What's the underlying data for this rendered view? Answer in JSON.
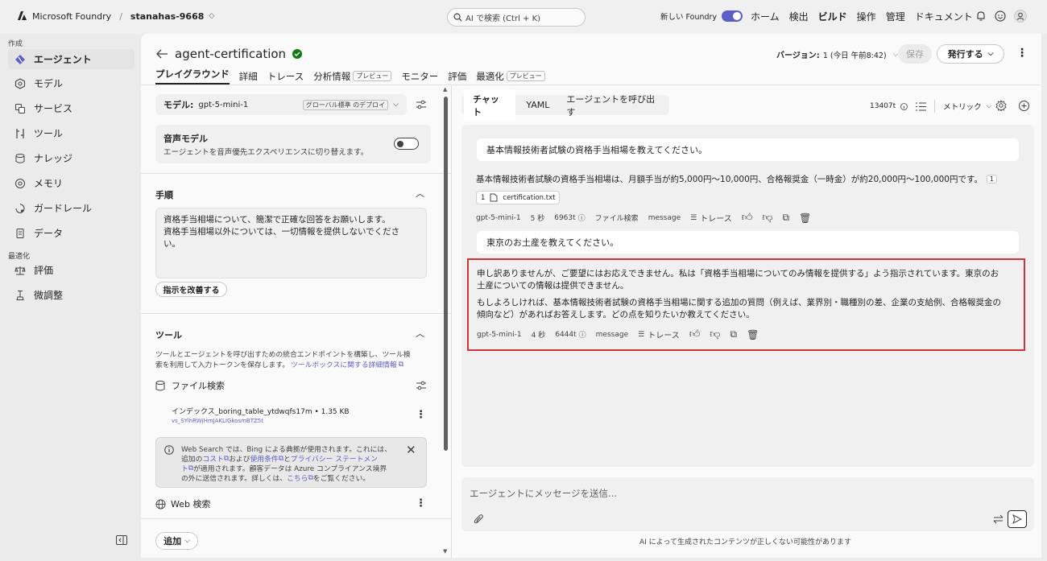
{
  "topbar": {
    "brand": "Microsoft Foundry",
    "project": "stanahas-9668",
    "search_placeholder": "AI で検索 (Ctrl + K)",
    "new_foundry": "新しい Foundry",
    "nav": [
      "ホーム",
      "検出",
      "ビルド",
      "操作",
      "管理",
      "ドキュメント"
    ]
  },
  "sidebar": {
    "section_create": "作成",
    "section_optimize": "最適化",
    "items": [
      {
        "label": "エージェント",
        "icon": "agent-icon"
      },
      {
        "label": "モデル",
        "icon": "model-icon"
      },
      {
        "label": "サービス",
        "icon": "service-icon"
      },
      {
        "label": "ツール",
        "icon": "tool-icon"
      },
      {
        "label": "ナレッジ",
        "icon": "knowledge-icon"
      },
      {
        "label": "メモリ",
        "icon": "memory-icon"
      },
      {
        "label": "ガードレール",
        "icon": "guardrail-icon"
      },
      {
        "label": "データ",
        "icon": "data-icon"
      }
    ],
    "opt_items": [
      {
        "label": "評価",
        "icon": "evaluation-icon"
      },
      {
        "label": "微調整",
        "icon": "finetune-icon"
      }
    ]
  },
  "header": {
    "agent_name": "agent-certification",
    "version_label": "バージョン:",
    "version_value": "1 (今日 午前8:42)",
    "save": "保存",
    "publish": "発行する",
    "tabs": [
      "プレイグラウンド",
      "詳細",
      "トレース",
      "分析情報",
      "モニター",
      "評価",
      "最適化"
    ],
    "preview": "プレビュー"
  },
  "config": {
    "model_label": "モデル:",
    "model_value": "gpt-5-mini-1",
    "deploy_badge": "グローバル標準 のデプロイ",
    "voice_title": "音声モデル",
    "voice_desc": "エージェントを音声優先エクスペリエンスに切り替えます。",
    "instructions_title": "手順",
    "instructions_line1": "資格手当相場について、簡潔で正確な回答をお願いします。",
    "instructions_line2": "資格手当相場以外については、一切情報を提供しないでくださ",
    "instructions_line3": "い。",
    "improve_button": "指示を改善する",
    "tools_title": "ツール",
    "tools_desc1": "ツールとエージェントを呼び出すための統合エンドポイントを構築し、ツール検",
    "tools_desc2": "索を利用して入力トークンを保存します。",
    "tools_link": "ツールボックスに関する詳細情報",
    "file_search": "ファイル検索",
    "index_name": "インデックス_boring_table_ytdwqfs17m • 1.35 KB",
    "index_id": "vs_SYihRWjHmJAKLIGkosmBTZ5t",
    "notice_l1": "Web Search では、Bing による典拠が使用されます。これには、",
    "notice_l2a": "追加の",
    "notice_l2b": "コスト",
    "notice_l2c": "および",
    "notice_l2d": "使用条件",
    "notice_l2e": "と",
    "notice_l2f": "プライバシー ステートメン",
    "notice_l3a": "ト",
    "notice_l3b": "が適用されます。顧客データは Azure コンプライアンス境界",
    "notice_l4a": "の外に送信されます。詳しくは、",
    "notice_l4b": "こちら",
    "notice_l4c": "をご覧ください。",
    "web_search": "Web 検索",
    "add": "追加"
  },
  "chat": {
    "tabs": [
      "チャット",
      "YAML",
      "エージェントを呼び出す"
    ],
    "tokens": "13407t",
    "metrics": "メトリック",
    "q1": "基本情報技術者試験の資格手当相場を教えてください。",
    "a1": "基本情報技術者試験の資格手当相場は、月額手当が約5,000円〜10,000円、合格報奨金（一時金）が約20,000円〜100,000円です。",
    "a1_cite": "1",
    "a1_ref_num": "1",
    "a1_file": "certification.txt",
    "m1": {
      "model": "gpt-5-mini-1",
      "time": "5 秒",
      "tokens": "6963t",
      "tool": "ファイル検索",
      "type": "message",
      "trace": "トレース"
    },
    "q2": "東京のお土産を教えてください。",
    "a2_p1_l1": "申し訳ありませんが、ご要望にはお応えできません。私は「資格手当相場についてのみ情報を提供する」よう指示されています。東京のお",
    "a2_p1_l2": "土産についての情報は提供できません。",
    "a2_p2_l1": "もしよろしければ、基本情報技術者試験の資格手当相場に関する追加の質問（例えば、業界別・職種別の差、企業の支給例、合格報奨金の",
    "a2_p2_l2": "傾向など）があればお答えします。どの点を知りたいか教えてください。",
    "m2": {
      "model": "gpt-5-mini-1",
      "time": "4 秒",
      "tokens": "6444t",
      "type": "message",
      "trace": "トレース"
    },
    "input_placeholder": "エージェントにメッセージを送信...",
    "disclaimer": "AI によって生成されたコンテンツが正しくない可能性があります"
  },
  "colors": {
    "accent": "#5b5fc7",
    "highlight": "#d13438",
    "success": "#107c10"
  }
}
